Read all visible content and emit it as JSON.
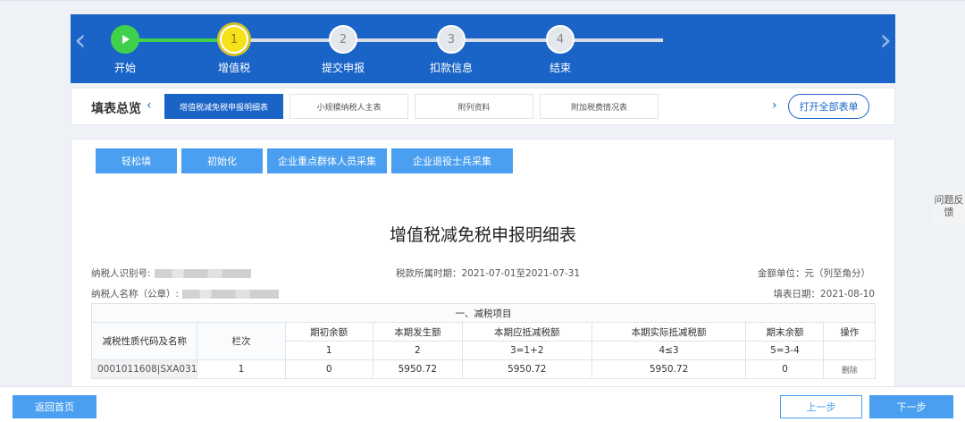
{
  "steps": {
    "items": [
      {
        "label": "开始",
        "num": "",
        "state": "done"
      },
      {
        "label": "增值税",
        "num": "1",
        "state": "current"
      },
      {
        "label": "提交申报",
        "num": "2",
        "state": "todo"
      },
      {
        "label": "扣款信息",
        "num": "3",
        "state": "todo"
      },
      {
        "label": "结束",
        "num": "4",
        "state": "todo"
      }
    ],
    "start_icon": "play-icon",
    "prev_icon": "chevron-left-icon",
    "next_icon": "chevron-right-icon"
  },
  "tabs": {
    "title": "填表总览",
    "items": [
      {
        "label": "增值税减免税申报明细表",
        "active": true
      },
      {
        "label": "小规模纳税人主表",
        "active": false
      },
      {
        "label": "附列资料",
        "active": false
      },
      {
        "label": "附加税费情况表",
        "active": false
      }
    ],
    "open_all": "打开全部表单"
  },
  "toolbar": [
    "轻松填",
    "初始化",
    "企业重点群体人员采集",
    "企业退役士兵采集"
  ],
  "form": {
    "title": "增值税减免税申报明细表",
    "taxpayer_id_label": "纳税人识别号:",
    "taxpayer_name_label": "纳税人名称（公章）:",
    "period": "税款所属时期：2021-07-01至2021-07-31",
    "unit": "金额单位：元（列至角分）",
    "fill_date": "填表日期：2021-08-10"
  },
  "table": {
    "section": "一、减税项目",
    "col_code": "减税性质代码及名称",
    "col_line": "栏次",
    "headers": [
      "期初余额",
      "本期发生额",
      "本期应抵减税额",
      "本期实际抵减税额",
      "期末余额",
      "操作"
    ],
    "formulas": [
      "1",
      "2",
      "3=1+2",
      "4≤3",
      "5=3-4",
      ""
    ],
    "rows": [
      {
        "code": "0001011608|SXA031",
        "line": "1",
        "opening": "0",
        "current": "5950.72",
        "deductible": "5950.72",
        "actual": "5950.72",
        "closing": "0",
        "action": "删除"
      }
    ]
  },
  "feedback": "问题反馈",
  "bottom": {
    "home": "返回首页",
    "prev": "上一步",
    "next": "下一步"
  },
  "colors": {
    "primary": "#1a64c8",
    "button": "#4a9ff0",
    "done": "#3fd14b",
    "current": "#f5e21b"
  }
}
